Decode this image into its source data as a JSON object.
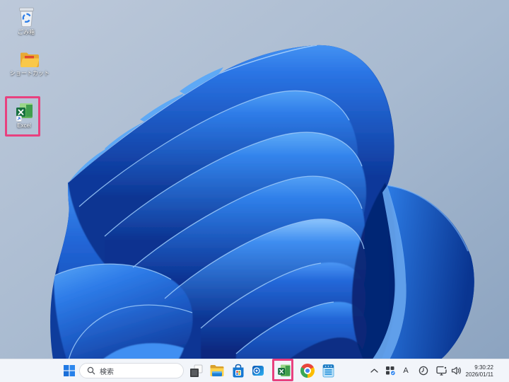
{
  "desktop": {
    "icons": [
      {
        "id": "recycle-bin",
        "label": "ごみ箱"
      },
      {
        "id": "shortcut-folder",
        "label": "ショートカット"
      },
      {
        "id": "excel-shortcut",
        "label": "Excel",
        "highlighted": true
      }
    ]
  },
  "taskbar": {
    "search": {
      "placeholder": "検索"
    },
    "apps": [
      "task-view",
      "file-explorer",
      "microsoft-store",
      "outlook",
      "excel",
      "chrome",
      "notepad"
    ],
    "excel_highlighted": true,
    "tray": {
      "icons": [
        "chevron-up",
        "windows-security",
        "ime-mode",
        "clock-app",
        "network-display",
        "volume"
      ],
      "ime_mode": "A",
      "time": "9:30:22",
      "date": "2026/01/11"
    }
  },
  "annotation": {
    "highlight_color": "#e8417f"
  },
  "wallpaper": {
    "name": "windows-11-bloom",
    "base_colors": [
      "#b9c6d8",
      "#2f7fe8",
      "#0a3ea6"
    ]
  }
}
